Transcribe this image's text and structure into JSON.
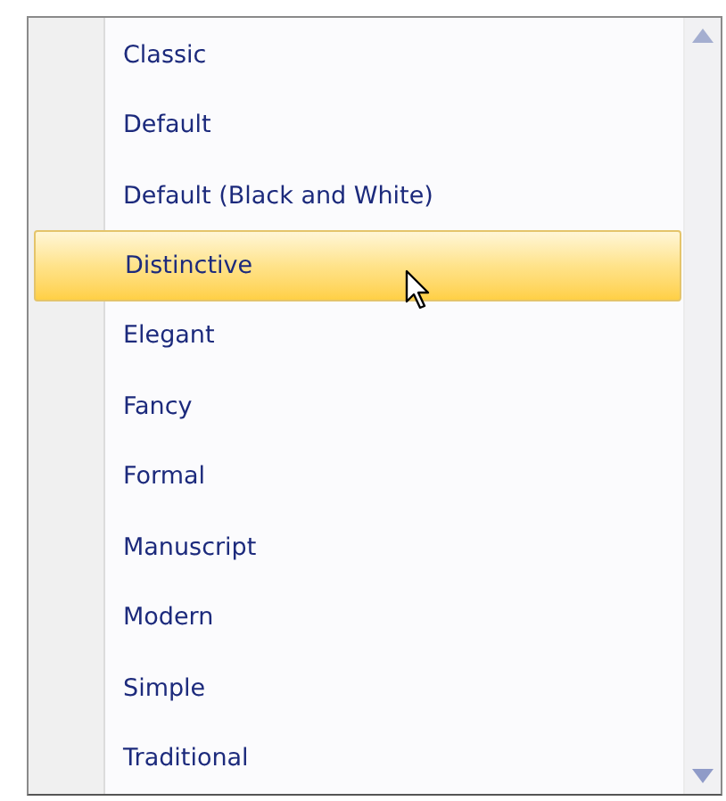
{
  "items": [
    {
      "label": "Classic",
      "selected": false
    },
    {
      "label": "Default",
      "selected": false
    },
    {
      "label": "Default (Black and White)",
      "selected": false
    },
    {
      "label": "Distinctive",
      "selected": true
    },
    {
      "label": "Elegant",
      "selected": false
    },
    {
      "label": "Fancy",
      "selected": false
    },
    {
      "label": "Formal",
      "selected": false
    },
    {
      "label": "Manuscript",
      "selected": false
    },
    {
      "label": "Modern",
      "selected": false
    },
    {
      "label": "Simple",
      "selected": false
    },
    {
      "label": "Traditional",
      "selected": false
    }
  ]
}
